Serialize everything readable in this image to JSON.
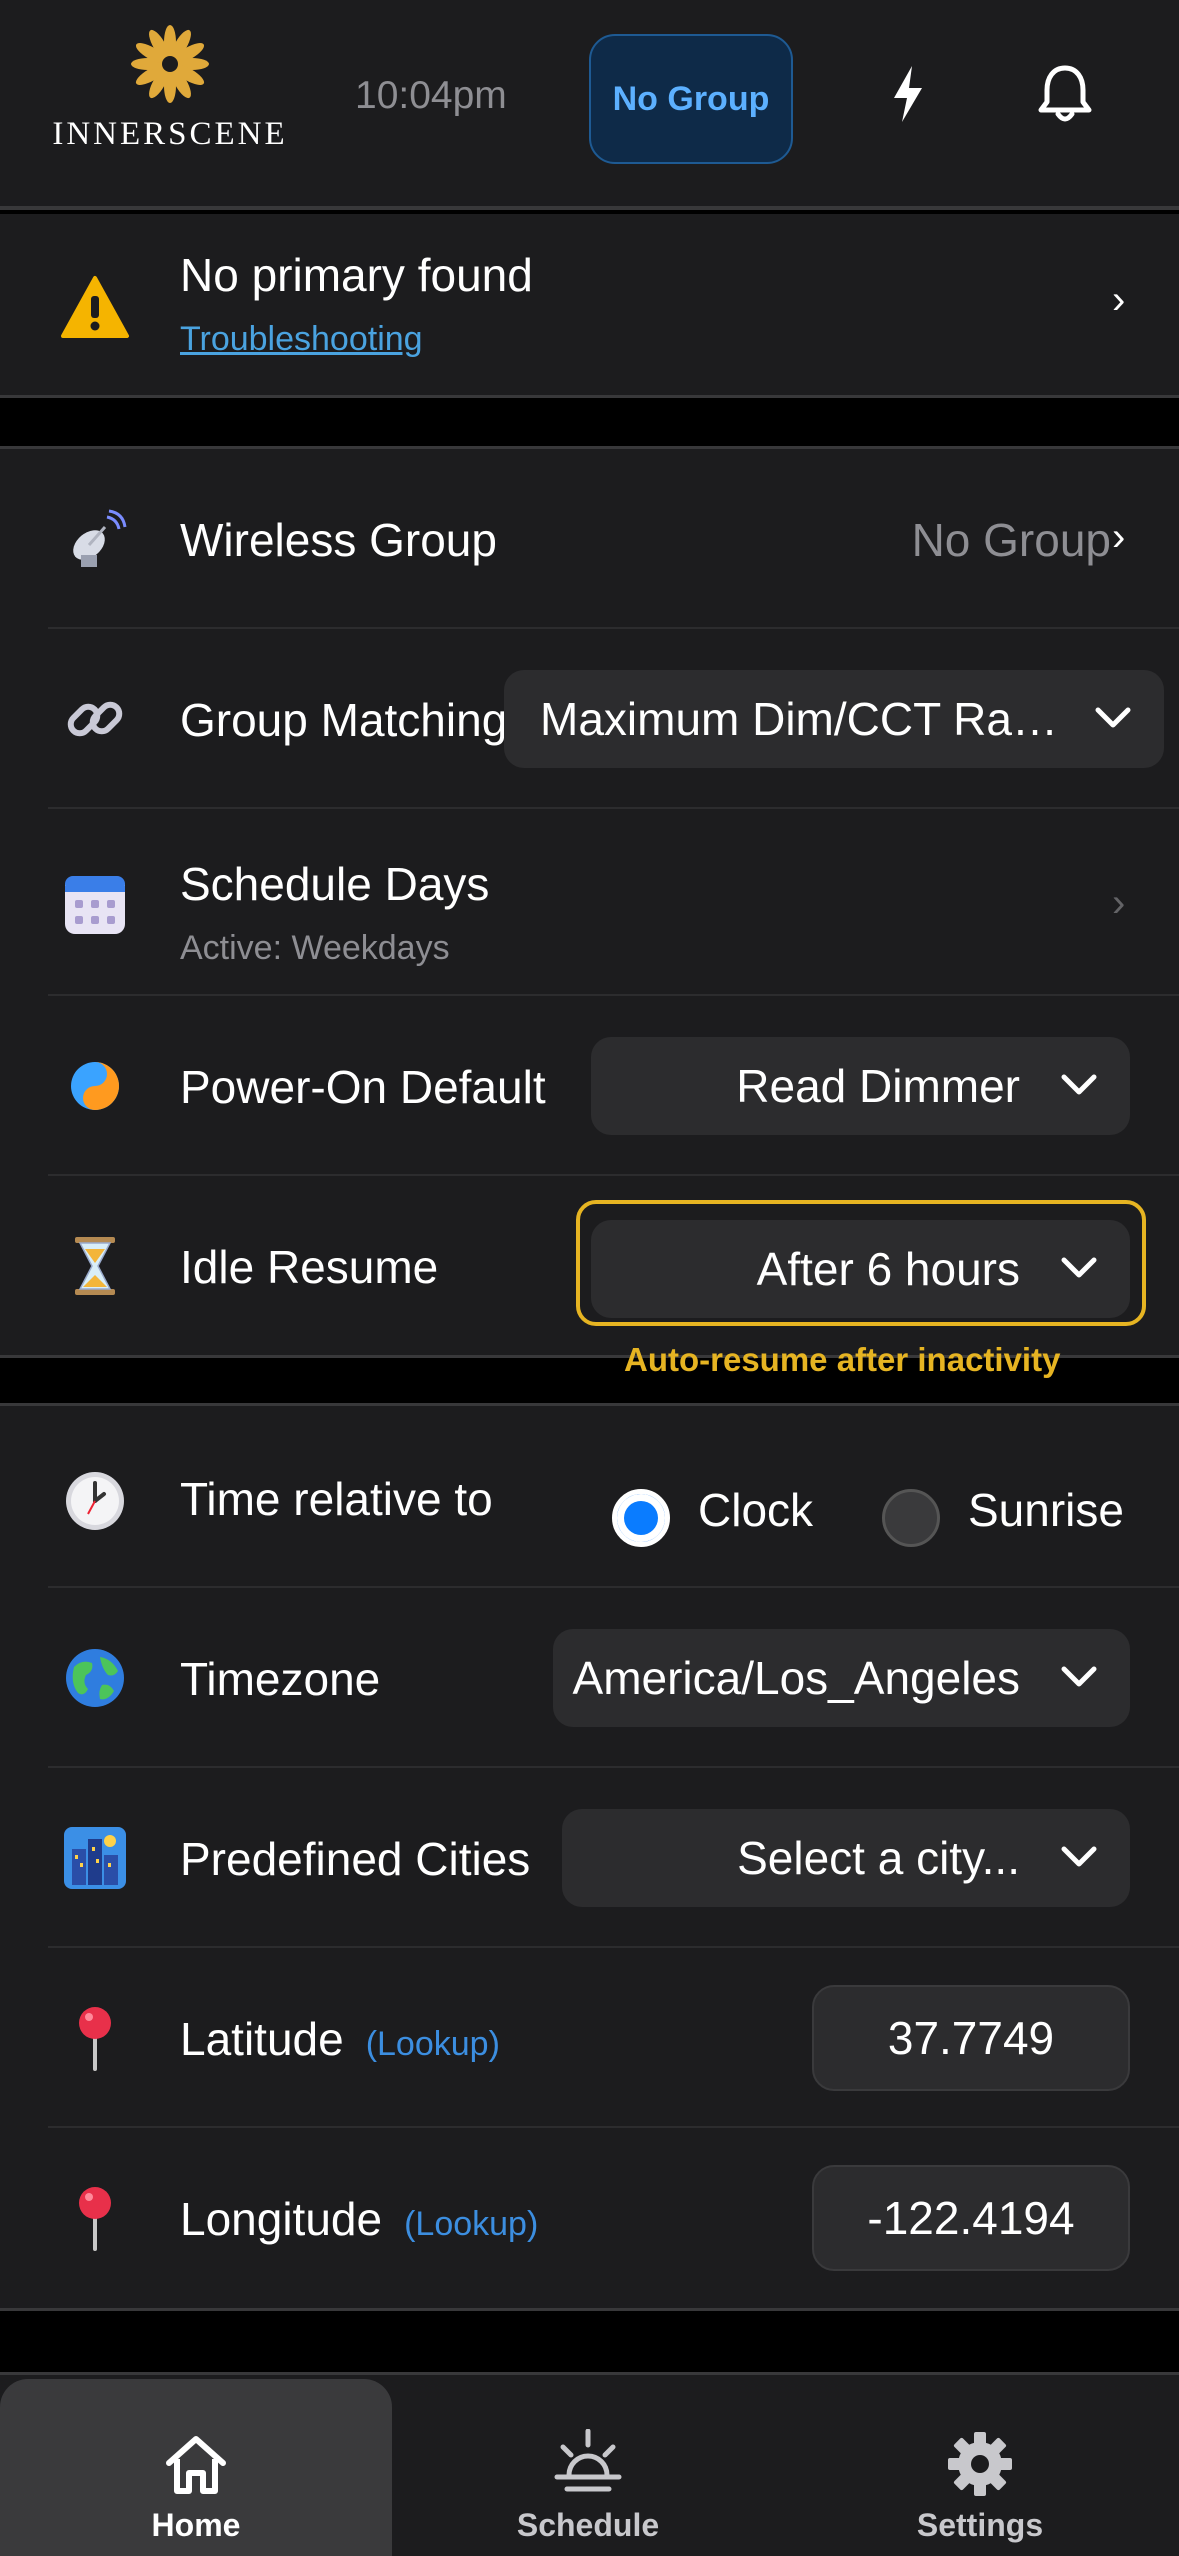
{
  "header": {
    "logo_text": "INNERSCENE",
    "time": "10:04pm",
    "group_button": "No Group"
  },
  "warning": {
    "title": "No primary found",
    "link": "Troubleshooting",
    "chevron": "›"
  },
  "rows": {
    "wireless_group": {
      "label": "Wireless Group",
      "value": "No Group",
      "chevron": "›"
    },
    "group_matching": {
      "label": "Group Matching",
      "selected": "Maximum Dim/CCT Ra…"
    },
    "schedule_days": {
      "label": "Schedule Days",
      "sub": "Active: Weekdays",
      "chevron": "›"
    },
    "power_on_default": {
      "label": "Power-On Default",
      "selected": "Read Dimmer"
    },
    "idle_resume": {
      "label": "Idle Resume",
      "selected": "After 6 hours",
      "hint": "Auto-resume after inactivity"
    },
    "time_relative": {
      "label": "Time relative to",
      "option_clock": "Clock",
      "option_sunrise": "Sunrise",
      "selected": "Clock"
    },
    "timezone": {
      "label": "Timezone",
      "selected": "America/Los_Angeles"
    },
    "predefined_cities": {
      "label": "Predefined Cities",
      "placeholder": "Select a city..."
    },
    "latitude": {
      "label": "Latitude",
      "lookup": "(Lookup)",
      "value": "37.7749"
    },
    "longitude": {
      "label": "Longitude",
      "lookup": "(Lookup)",
      "value": "-122.4194"
    }
  },
  "tabs": [
    {
      "label": "Home",
      "active": true
    },
    {
      "label": "Schedule",
      "active": false
    },
    {
      "label": "Settings",
      "active": false
    }
  ],
  "colors": {
    "accent_blue": "#0a7cff",
    "highlight_gold": "#e6b422",
    "link_blue": "#4aa3e0",
    "background": "#1c1c1e"
  }
}
